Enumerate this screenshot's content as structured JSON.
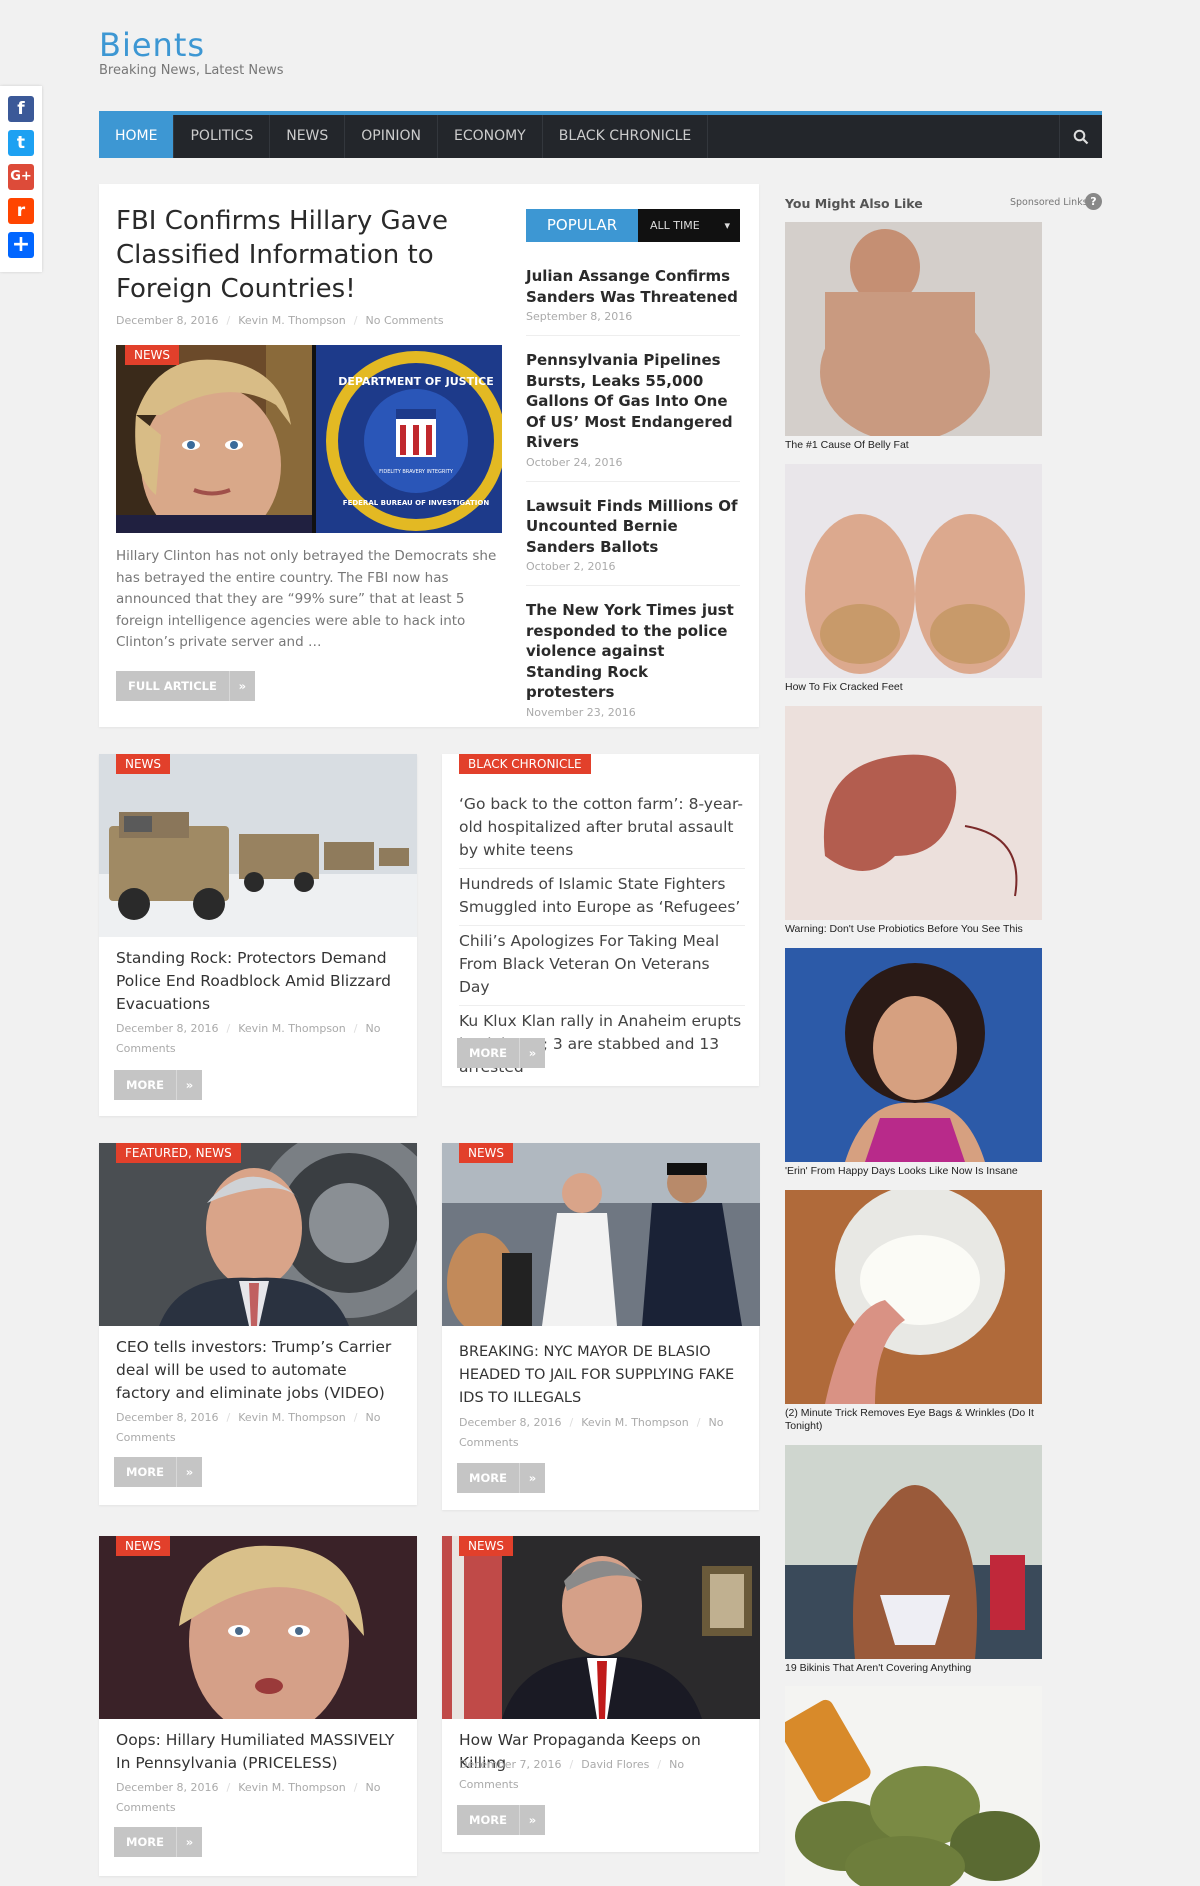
{
  "site": {
    "title": "Bients",
    "tagline": "Breaking News, Latest News"
  },
  "share": [
    {
      "name": "facebook-icon",
      "glyph": "f",
      "color": "#3b5998"
    },
    {
      "name": "twitter-icon",
      "glyph": "t",
      "color": "#1da1f2"
    },
    {
      "name": "google-plus-icon",
      "glyph": "G+",
      "color": "#dd4b39"
    },
    {
      "name": "reddit-icon",
      "glyph": "r",
      "color": "#ff4500"
    },
    {
      "name": "add-share-icon",
      "glyph": "+",
      "color": "#0166ff"
    }
  ],
  "nav": {
    "items": [
      "HOME",
      "POLITICS",
      "NEWS",
      "OPINION",
      "ECONOMY",
      "BLACK CHRONICLE"
    ],
    "active": "HOME",
    "search_icon": "search-icon"
  },
  "featured": {
    "tag": "NEWS",
    "title": "FBI Confirms Hillary Gave Classified Information to Foreign Countries!",
    "date": "December 8, 2016",
    "author": "Kevin M. Thompson",
    "comments": "No Comments",
    "excerpt": "Hillary Clinton has not only betrayed the Democrats she has betrayed the entire country. The FBI now has announced that they are “99% sure” that at least 5 foreign intelligence agencies were able to hack into Clinton’s private server and …",
    "button": "FULL ARTICLE",
    "seal_top": "DEPARTMENT OF JUSTICE",
    "seal_side": "FEDERAL BUREAU OF INVESTIGATION",
    "seal_motto": "FIDELITY BRAVERY INTEGRITY"
  },
  "popular": {
    "tab_active": "POPULAR",
    "tab_other": "ALL TIME",
    "items": [
      {
        "title": "Julian Assange Confirms Sanders Was Threatened",
        "date": "September 8, 2016"
      },
      {
        "title": "Pennsylvania Pipelines Bursts, Leaks 55,000 Gallons Of Gas Into One Of US’ Most Endangered Rivers",
        "date": "October 24, 2016"
      },
      {
        "title": "Lawsuit Finds Millions Of Uncounted Bernie Sanders Ballots",
        "date": "October 2, 2016"
      },
      {
        "title": "The New York Times just responded to the police violence against Standing Rock protesters",
        "date": "November 23, 2016"
      }
    ]
  },
  "cards": [
    {
      "tag": "NEWS",
      "title": "Standing Rock: Protectors Demand Police End Roadblock Amid Blizzard Evacuations",
      "date": "December 8, 2016",
      "author": "Kevin M. Thompson",
      "comments": "No Comments",
      "button": "MORE"
    },
    {
      "tag": "FEATURED, NEWS",
      "title": "CEO tells investors: Trump’s Carrier deal will be used to automate factory and eliminate jobs (VIDEO)",
      "date": "December 8, 2016",
      "author": "Kevin M. Thompson",
      "comments": "No Comments",
      "button": "MORE"
    },
    {
      "tag": "NEWS",
      "title": "BREAKING: NYC MAYOR DE BLASIO HEADED TO JAIL FOR SUPPLYING FAKE IDS TO ILLEGALS",
      "date": "December 8, 2016",
      "author": "Kevin M. Thompson",
      "comments": "No Comments",
      "button": "MORE"
    },
    {
      "tag": "NEWS",
      "title": "Oops: Hillary Humiliated MASSIVELY In Pennsylvania (PRICELESS)",
      "date": "December 8, 2016",
      "author": "Kevin M. Thompson",
      "comments": "No Comments",
      "button": "MORE"
    },
    {
      "tag": "NEWS",
      "title": "How War Propaganda Keeps on Killing",
      "date": "December 7, 2016",
      "author": "David Flores",
      "comments": "No Comments",
      "button": "MORE"
    }
  ],
  "black_chronicle": {
    "tag": "BLACK CHRONICLE",
    "items": [
      "‘Go back to the cotton farm’: 8-year-old hospitalized after brutal assault by white teens",
      "Hundreds of Islamic State Fighters Smuggled into Europe as ‘Refugees’",
      "Chili’s Apologizes For Taking Meal From Black Veteran On Veterans Day",
      "Ku Klux Klan rally in Anaheim erupts in violence; 3 are stabbed and 13 arrested"
    ],
    "button": "MORE"
  },
  "sidebar": {
    "heading": "You Might Also Like",
    "sponsored": "Sponsored Links",
    "help": "?",
    "ads": [
      "The #1 Cause Of Belly Fat",
      "How To Fix Cracked Feet",
      "Warning: Don't Use Probiotics Before You See This",
      "'Erin' From Happy Days Looks Like Now Is Insane",
      "(2) Minute Trick Removes Eye Bags & Wrinkles (Do It Tonight)",
      "19 Bikinis That Aren't Covering Anything"
    ]
  },
  "colors": {
    "accent": "#3d97d3",
    "tag": "#e2402b",
    "nav_bg": "#23262b"
  }
}
